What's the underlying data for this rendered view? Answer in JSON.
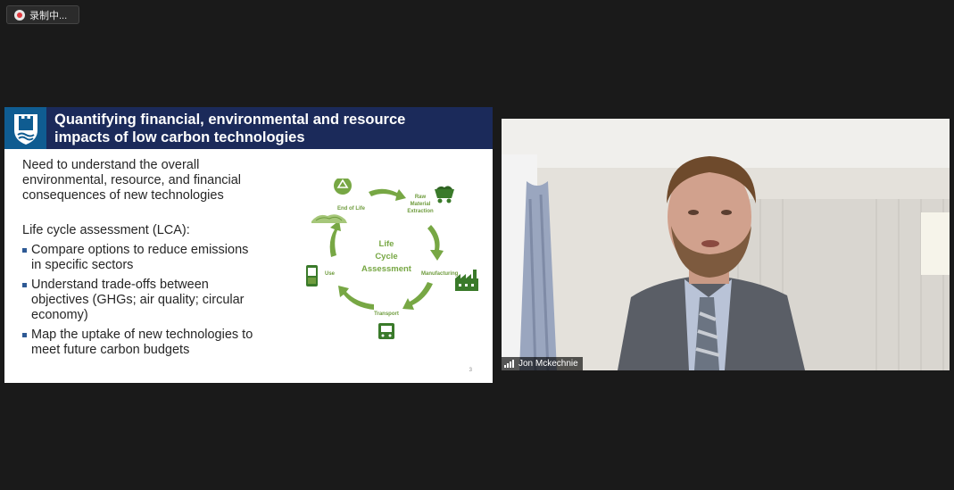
{
  "recording": {
    "label": "录制中..."
  },
  "slide": {
    "title_lines": [
      "Quantifying financial, environmental and resource",
      "impacts of low carbon technologies"
    ],
    "intro_lines": [
      "Need to understand the overall",
      "environmental, resource, and financial",
      "consequences of new technologies"
    ],
    "lca_heading": "Life cycle assessment (LCA):",
    "bullets": [
      {
        "lines": [
          "Compare options to reduce emissions",
          "in specific sectors"
        ]
      },
      {
        "lines": [
          "Understand trade-offs between",
          "objectives (GHGs; air quality; circular",
          "economy)"
        ]
      },
      {
        "lines": [
          "Map the uptake of new technologies to",
          "meet future carbon budgets"
        ]
      }
    ],
    "page_number": "3",
    "diagram": {
      "center_lines": [
        "Life",
        "Cycle",
        "Assessment"
      ],
      "stages": {
        "end_of_life": "End of Life",
        "raw_material": [
          "Raw",
          "Material",
          "Extraction"
        ],
        "manufacturing": "Manufacturing",
        "transport": "Transport",
        "use": "Use"
      },
      "accent_color": "#77a744"
    }
  },
  "video": {
    "participant_name": "Jon Mckechnie"
  }
}
